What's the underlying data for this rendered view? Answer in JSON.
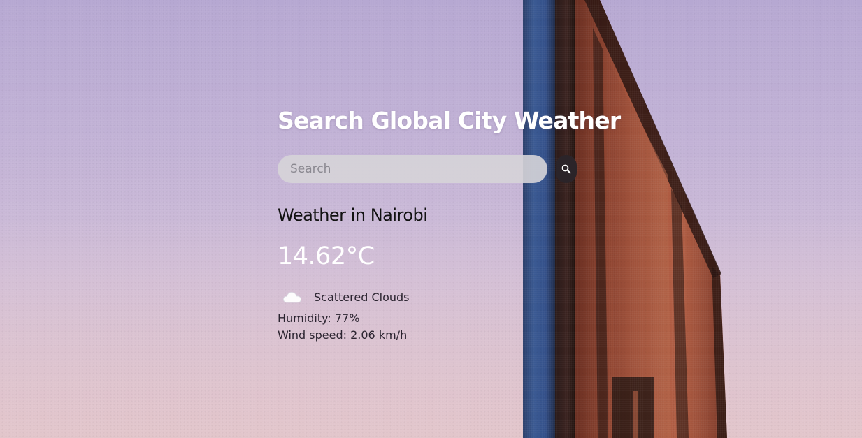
{
  "page": {
    "title": "Search Global City Weather"
  },
  "search": {
    "placeholder": "Search",
    "value": "",
    "button_icon": "search-icon"
  },
  "weather": {
    "heading": "Weather in Nairobi",
    "temperature": "14.62°C",
    "condition_icon": "cloud-icon",
    "description": "Scattered Clouds",
    "humidity": "Humidity: 77%",
    "wind": "Wind speed: 2.06 km/h"
  },
  "colors": {
    "title_text": "#ffffff",
    "temperature_text": "#ffffff",
    "search_field_bg": "#d6d4d8",
    "search_button_bg": "#2b2429",
    "sky_top": "#b6a8d2",
    "sky_bottom": "#dcc5cf"
  }
}
